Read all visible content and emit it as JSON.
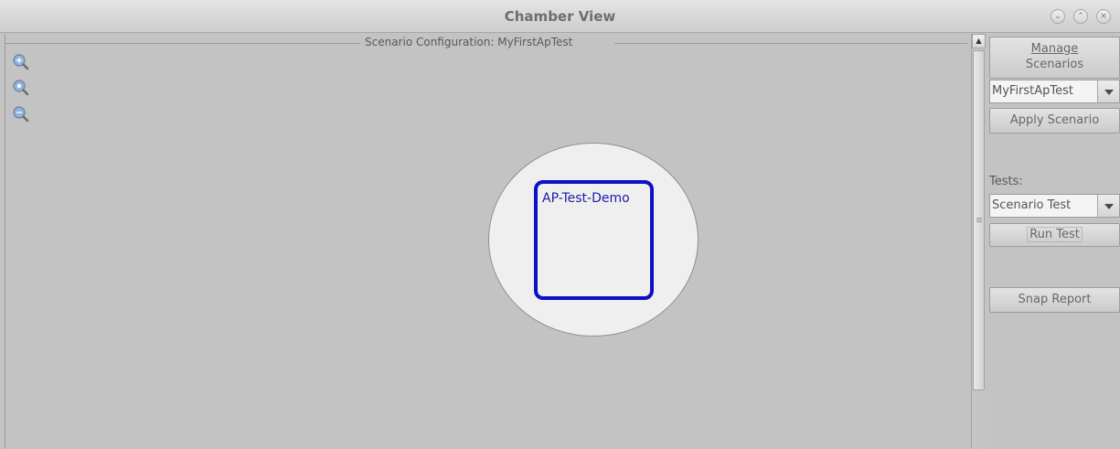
{
  "window": {
    "title": "Chamber View",
    "controls": [
      "minimize-icon",
      "maximize-icon",
      "close-icon"
    ]
  },
  "canvas": {
    "legend": "Scenario Configuration:  MyFirstApTest",
    "zoom_icons": [
      "zoom-in-icon",
      "zoom-reset-icon",
      "zoom-out-icon"
    ],
    "device_label": "AP-Test-Demo",
    "colors": {
      "device_border": "#0e10c8",
      "circle_fill": "#efefef",
      "background": "#c3c3c3"
    }
  },
  "sidebar": {
    "manage_line1": "Manage",
    "manage_line2": "Scenarios",
    "scenario_select": "MyFirstApTest",
    "apply_label": "Apply Scenario",
    "tests_label": "Tests:",
    "test_select": "Scenario Test",
    "run_label": "Run Test",
    "snap_label": "Snap Report"
  }
}
